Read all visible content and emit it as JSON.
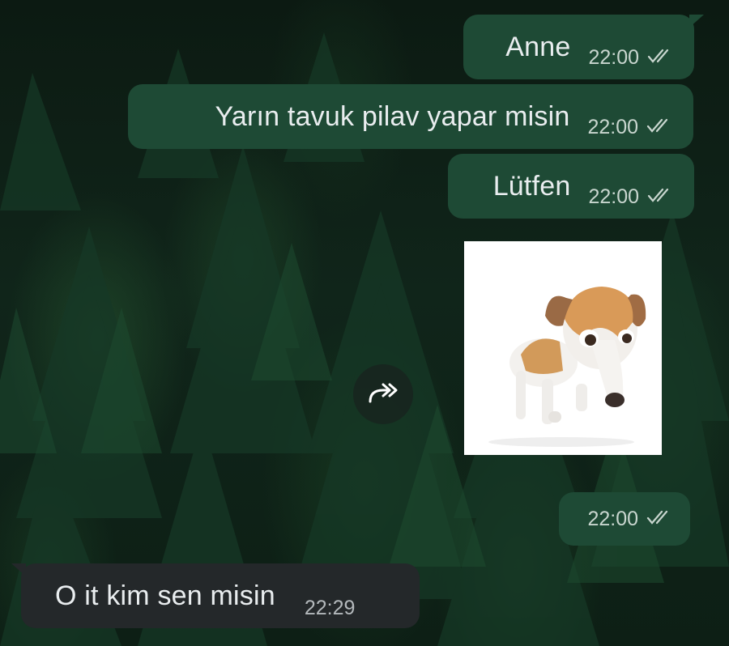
{
  "colors": {
    "outgoing_bubble": "#1e4a35",
    "incoming_bubble": "#24282a",
    "message_text": "#e9edef",
    "background": "#0d1f15"
  },
  "messages": [
    {
      "direction": "outgoing",
      "text": "Anne",
      "time": "22:00",
      "status": "read-double-check-icon"
    },
    {
      "direction": "outgoing",
      "text": "Yarın tavuk pilav yapar misin",
      "time": "22:00",
      "status": "read-double-check-icon"
    },
    {
      "direction": "outgoing",
      "text": "Lütfen",
      "time": "22:00",
      "status": "read-double-check-icon"
    },
    {
      "direction": "outgoing",
      "type": "image",
      "content": "dog-photo",
      "time": "22:00",
      "status": "read-double-check-icon"
    },
    {
      "direction": "incoming",
      "text": "O it kim sen misin",
      "time": "22:29"
    }
  ],
  "actions": {
    "forward_icon": "forward-icon"
  }
}
